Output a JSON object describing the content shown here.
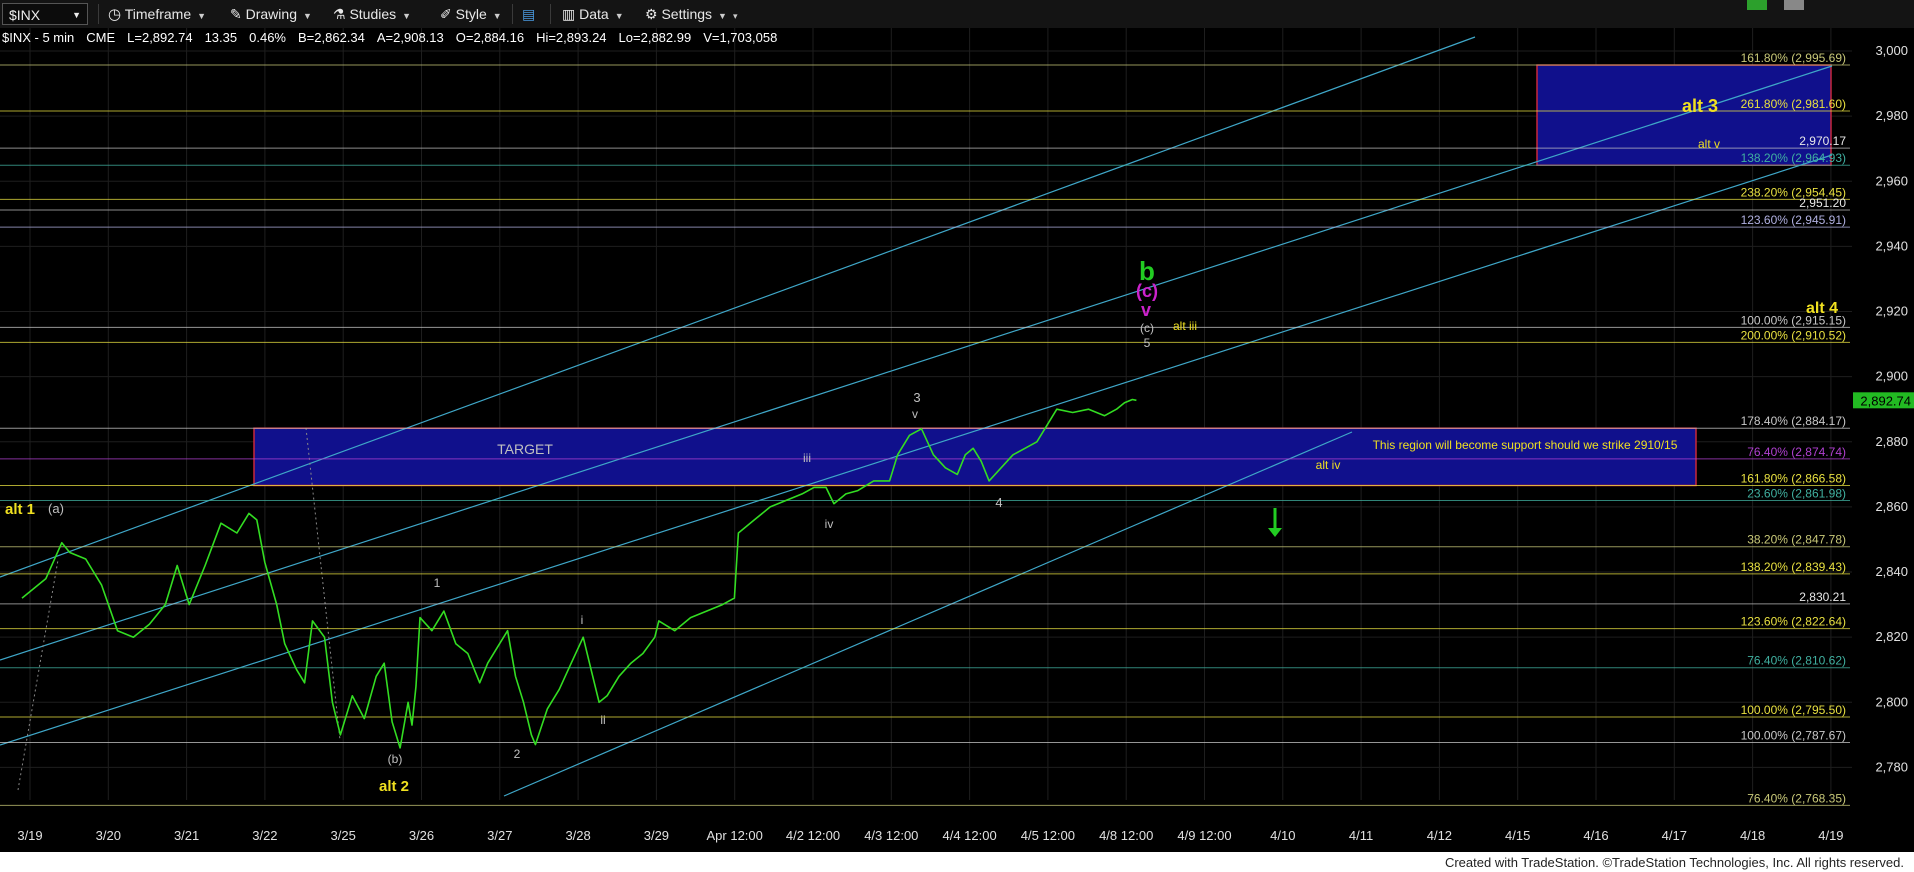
{
  "toolbar": {
    "symbol": "$INX",
    "timeframe_label": "Timeframe",
    "drawing_label": "Drawing",
    "studies_label": "Studies",
    "style_label": "Style",
    "data_label": "Data",
    "settings_label": "Settings"
  },
  "quote": {
    "symbol_interval": "$INX - 5 min",
    "exchange": "CME",
    "last": "L=2,892.74",
    "change": "13.35",
    "change_pct": "0.46%",
    "bid": "B=2,862.34",
    "ask": "A=2,908.13",
    "open": "O=2,884.16",
    "high": "Hi=2,893.24",
    "low": "Lo=2,882.99",
    "volume": "V=1,703,058"
  },
  "footer": "Created with TradeStation. ©TradeStation Technologies, Inc. All rights reserved.",
  "chart_data": {
    "type": "line",
    "title": "",
    "xlabel": "",
    "ylabel": "",
    "ylim": [
      2770,
      3004
    ],
    "grid": true,
    "y_ticks": [
      2780,
      2800,
      2820,
      2840,
      2860,
      2880,
      2900,
      2920,
      2940,
      2960,
      2980,
      3000
    ],
    "y_tick_labels": [
      "2,780",
      "2,800",
      "2,820",
      "2,840",
      "2,860",
      "2,880",
      "2,900",
      "2,920",
      "2,940",
      "2,960",
      "2,980",
      "3,000"
    ],
    "x_labels": [
      "3/19",
      "3/20",
      "3/21",
      "3/22",
      "3/25",
      "3/26",
      "3/27",
      "3/28",
      "3/29",
      "Apr 12:00",
      "4/2 12:00",
      "4/3 12:00",
      "4/4 12:00",
      "4/5 12:00",
      "4/8 12:00",
      "4/9 12:00",
      "4/10",
      "4/11",
      "4/12",
      "4/15",
      "4/16",
      "4/17",
      "4/18",
      "4/19"
    ],
    "last_price_label": "2,892.74",
    "price_series": {
      "name": "",
      "color": "#33dd22",
      "points": [
        [
          0,
          2832
        ],
        [
          0.3,
          2838
        ],
        [
          0.5,
          2849
        ],
        [
          0.6,
          2846
        ],
        [
          0.8,
          2844
        ],
        [
          1.0,
          2836
        ],
        [
          1.2,
          2822
        ],
        [
          1.4,
          2820
        ],
        [
          1.6,
          2824
        ],
        [
          1.8,
          2830
        ],
        [
          1.95,
          2842
        ],
        [
          2.1,
          2830
        ],
        [
          2.3,
          2842
        ],
        [
          2.5,
          2855
        ],
        [
          2.7,
          2852
        ],
        [
          2.85,
          2858
        ],
        [
          2.95,
          2856
        ],
        [
          3.05,
          2843
        ],
        [
          3.2,
          2830
        ],
        [
          3.3,
          2818
        ],
        [
          3.45,
          2810
        ],
        [
          3.55,
          2806
        ],
        [
          3.65,
          2825
        ],
        [
          3.8,
          2820
        ],
        [
          3.9,
          2800
        ],
        [
          4.0,
          2790
        ],
        [
          4.15,
          2802
        ],
        [
          4.3,
          2795
        ],
        [
          4.45,
          2808
        ],
        [
          4.55,
          2812
        ],
        [
          4.65,
          2794
        ],
        [
          4.75,
          2786
        ],
        [
          4.85,
          2800
        ],
        [
          4.9,
          2793
        ],
        [
          4.95,
          2805
        ],
        [
          5.0,
          2826
        ],
        [
          5.15,
          2822
        ],
        [
          5.3,
          2828
        ],
        [
          5.45,
          2818
        ],
        [
          5.6,
          2815
        ],
        [
          5.75,
          2806
        ],
        [
          5.85,
          2812
        ],
        [
          6.0,
          2818
        ],
        [
          6.1,
          2822
        ],
        [
          6.2,
          2808
        ],
        [
          6.3,
          2800
        ],
        [
          6.4,
          2790
        ],
        [
          6.45,
          2787
        ],
        [
          6.6,
          2798
        ],
        [
          6.75,
          2804
        ],
        [
          6.9,
          2812
        ],
        [
          7.05,
          2820
        ],
        [
          7.15,
          2810
        ],
        [
          7.25,
          2800
        ],
        [
          7.35,
          2802
        ],
        [
          7.5,
          2808
        ],
        [
          7.65,
          2812
        ],
        [
          7.8,
          2815
        ],
        [
          7.95,
          2820
        ],
        [
          8.0,
          2825
        ],
        [
          8.2,
          2822
        ],
        [
          8.4,
          2826
        ],
        [
          8.6,
          2828
        ],
        [
          8.8,
          2830
        ],
        [
          8.95,
          2832
        ],
        [
          9.0,
          2852
        ],
        [
          9.2,
          2856
        ],
        [
          9.4,
          2860
        ],
        [
          9.6,
          2862
        ],
        [
          9.8,
          2864
        ],
        [
          9.95,
          2866
        ],
        [
          10.1,
          2866
        ],
        [
          10.2,
          2861
        ],
        [
          10.35,
          2864
        ],
        [
          10.5,
          2865
        ],
        [
          10.7,
          2868
        ],
        [
          10.9,
          2868
        ],
        [
          11.0,
          2876
        ],
        [
          11.15,
          2882
        ],
        [
          11.3,
          2884
        ],
        [
          11.45,
          2876
        ],
        [
          11.6,
          2872
        ],
        [
          11.75,
          2870
        ],
        [
          11.85,
          2876
        ],
        [
          11.95,
          2878
        ],
        [
          12.05,
          2874
        ],
        [
          12.15,
          2868
        ],
        [
          12.3,
          2872
        ],
        [
          12.45,
          2876
        ],
        [
          12.6,
          2878
        ],
        [
          12.75,
          2880
        ],
        [
          12.9,
          2886
        ],
        [
          13.0,
          2890
        ],
        [
          13.2,
          2889
        ],
        [
          13.4,
          2890
        ],
        [
          13.6,
          2888
        ],
        [
          13.75,
          2890
        ],
        [
          13.85,
          2892
        ],
        [
          13.95,
          2893
        ],
        [
          14.0,
          2892.74
        ]
      ]
    },
    "fib_levels": [
      {
        "label": "161.80% (2,995.69)",
        "value": 2995.69,
        "color": "#c8c878"
      },
      {
        "label": "261.80% (2,981.60)",
        "value": 2981.6,
        "color": "#e8e040"
      },
      {
        "label": "138.20% (2,964.93)",
        "value": 2964.93,
        "color": "#40b0a0"
      },
      {
        "label": "238.20% (2,954.45)",
        "value": 2954.45,
        "color": "#e8e040"
      },
      {
        "label": "123.60% (2,945.91)",
        "value": 2945.91,
        "color": "#b0b0e0"
      },
      {
        "label": "100.00% (2,915.15)",
        "value": 2915.15,
        "color": "#c8c8c8"
      },
      {
        "label": "200.00% (2,910.52)",
        "value": 2910.52,
        "color": "#e8e040"
      },
      {
        "label": "178.40% (2,884.17)",
        "value": 2884.17,
        "color": "#c8c8c8"
      },
      {
        "label": "76.40% (2,874.74)",
        "value": 2874.74,
        "color": "#b040d0"
      },
      {
        "label": "161.80% (2,866.58)",
        "value": 2866.58,
        "color": "#e8e040"
      },
      {
        "label": "23.60% (2,861.98)",
        "value": 2861.98,
        "color": "#40b0a0"
      },
      {
        "label": "38.20% (2,847.78)",
        "value": 2847.78,
        "color": "#c8c878"
      },
      {
        "label": "138.20% (2,839.43)",
        "value": 2839.43,
        "color": "#e8e040"
      },
      {
        "label": "123.60% (2,822.64)",
        "value": 2822.64,
        "color": "#e8e040"
      },
      {
        "label": "76.40% (2,810.62)",
        "value": 2810.62,
        "color": "#40b0a0"
      },
      {
        "label": "100.00% (2,795.50)",
        "value": 2795.5,
        "color": "#e8e040"
      },
      {
        "label": "100.00% (2,787.67)",
        "value": 2787.67,
        "color": "#c8c8c8"
      },
      {
        "label": "76.40% (2,768.35)",
        "value": 2768.35,
        "color": "#c8c878"
      }
    ],
    "level_labels": [
      {
        "label": "2,970.17",
        "value": 2970.17
      },
      {
        "label": "2,951.20",
        "value": 2951.2
      },
      {
        "label": "2,830.21",
        "value": 2830.21
      }
    ],
    "annotations": [
      {
        "text": "alt 3",
        "color": "#f0e020"
      },
      {
        "text": "alt v",
        "color": "#f0e020"
      },
      {
        "text": "alt 4",
        "color": "#f0e020"
      },
      {
        "text": "b",
        "color": "#22cc22"
      },
      {
        "text": "(c)",
        "color": "#cc22cc"
      },
      {
        "text": "v",
        "color": "#cc22cc"
      },
      {
        "text": "(c)",
        "color": "#c0c0c0"
      },
      {
        "text": "5",
        "color": "#c0c0c0"
      },
      {
        "text": "alt iii",
        "color": "#f0e020"
      },
      {
        "text": "3",
        "color": "#c0c0c0"
      },
      {
        "text": "v",
        "color": "#c0c0c0"
      },
      {
        "text": "iii",
        "color": "#c0c0c0"
      },
      {
        "text": "iv",
        "color": "#c0c0c0"
      },
      {
        "text": "4",
        "color": "#c0c0c0"
      },
      {
        "text": "TARGET",
        "color": "#c0c0c0"
      },
      {
        "text": "This region will become support should we strike 2910/15",
        "color": "#f0e020"
      },
      {
        "text": "alt iv",
        "color": "#f0e020"
      },
      {
        "text": "alt 1",
        "color": "#f0e020"
      },
      {
        "text": "(a)",
        "color": "#c0c0c0"
      },
      {
        "text": "1",
        "color": "#c0c0c0"
      },
      {
        "text": "i",
        "color": "#c0c0c0"
      },
      {
        "text": "ii",
        "color": "#c0c0c0"
      },
      {
        "text": "2",
        "color": "#c0c0c0"
      },
      {
        "text": "(b)",
        "color": "#c0c0c0"
      },
      {
        "text": "alt 2",
        "color": "#f0e020"
      }
    ],
    "zones": [
      {
        "name": "alt 3 box",
        "y_low": 2964.93,
        "y_high": 2995.69
      },
      {
        "name": "target box",
        "y_low": 2866.58,
        "y_high": 2884.17
      }
    ],
    "colors": {
      "background": "#000000",
      "grid": "#1e1e1e",
      "channel": "#3fa7c8",
      "zone_fill": "#10108c",
      "zone_border": "#c8283c",
      "arrow": "#22cc22"
    }
  }
}
